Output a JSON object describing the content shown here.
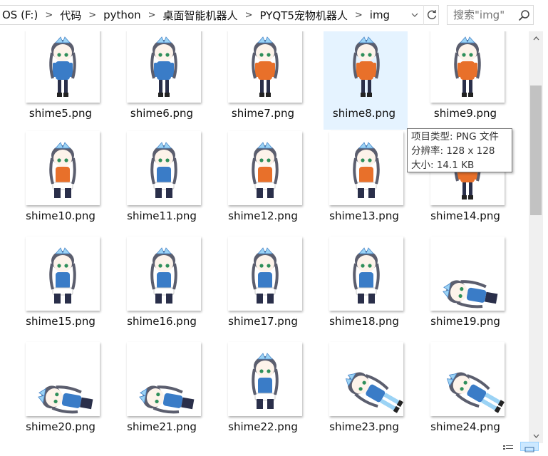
{
  "address_bar": {
    "breadcrumbs": [
      "OS (F:)",
      "代码",
      "python",
      "桌面智能机器人",
      "PYQT5宠物机器人",
      "img"
    ],
    "separator": ">",
    "dropdown_icon": "chevron-down-icon",
    "refresh_icon": "refresh-icon"
  },
  "search": {
    "placeholder": "搜索\"img\"",
    "icon": "search-icon"
  },
  "files": [
    {
      "name": "shime5.png",
      "pose": "stand",
      "outfit": "#3a7cc7"
    },
    {
      "name": "shime6.png",
      "pose": "stand",
      "outfit": "#3a7cc7"
    },
    {
      "name": "shime7.png",
      "pose": "stand",
      "outfit": "#e8702a"
    },
    {
      "name": "shime8.png",
      "pose": "stand",
      "outfit": "#e8702a",
      "selected": true
    },
    {
      "name": "shime9.png",
      "pose": "walk",
      "outfit": "#e8702a"
    },
    {
      "name": "shime10.png",
      "pose": "sit",
      "outfit": "#e8702a"
    },
    {
      "name": "shime11.png",
      "pose": "sit",
      "outfit": "#3a7cc7"
    },
    {
      "name": "shime12.png",
      "pose": "sit",
      "outfit": "#e8702a"
    },
    {
      "name": "shime13.png",
      "pose": "sit",
      "outfit": "#e8702a"
    },
    {
      "name": "shime14.png",
      "pose": "stand",
      "outfit": "#e8702a"
    },
    {
      "name": "shime15.png",
      "pose": "sit",
      "outfit": "#3a7cc7"
    },
    {
      "name": "shime16.png",
      "pose": "sit",
      "outfit": "#3a7cc7"
    },
    {
      "name": "shime17.png",
      "pose": "sit",
      "outfit": "#3a7cc7"
    },
    {
      "name": "shime18.png",
      "pose": "cry",
      "outfit": "#3a7cc7"
    },
    {
      "name": "shime19.png",
      "pose": "lie",
      "outfit": "#3a7cc7"
    },
    {
      "name": "shime20.png",
      "pose": "lie",
      "outfit": "#3a7cc7"
    },
    {
      "name": "shime21.png",
      "pose": "lie",
      "outfit": "#3a7cc7"
    },
    {
      "name": "shime22.png",
      "pose": "sit",
      "outfit": "#3a7cc7"
    },
    {
      "name": "shime23.png",
      "pose": "fall",
      "outfit": "#3a7cc7"
    },
    {
      "name": "shime24.png",
      "pose": "fall",
      "outfit": "#3a7cc7"
    }
  ],
  "tooltip": {
    "type_line": "项目类型: PNG 文件",
    "resolution_line": "分辨率: 128 x 128",
    "size_line": "大小: 14.1 KB"
  },
  "colors": {
    "selection": "#e5f3ff",
    "hair": "#5b5e6e",
    "bow": "#9bd3f5"
  },
  "status_bar": {
    "details_view_icon": "details-view-icon",
    "large_icons_view_icon": "large-icons-view-icon"
  }
}
